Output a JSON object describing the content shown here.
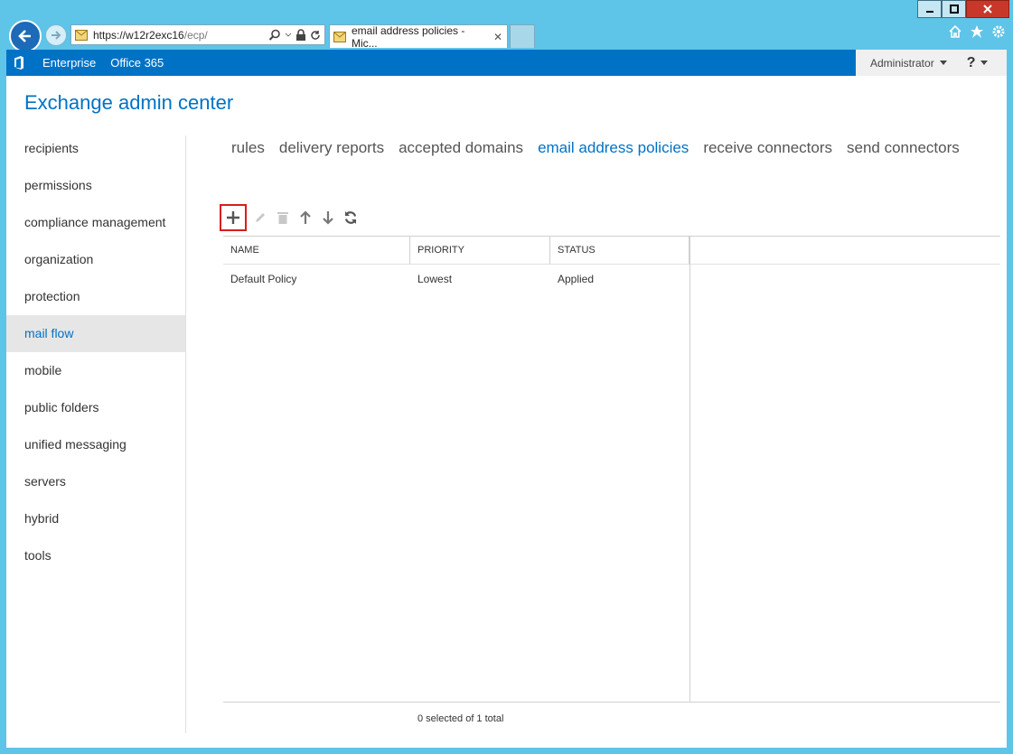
{
  "browser": {
    "address_host": "https://w12r2exc16",
    "address_path": "/ecp/",
    "tab_title": "email address policies - Mic...",
    "tab_close": "✕"
  },
  "topnav": {
    "enterprise": "Enterprise",
    "office365": "Office 365",
    "user": "Administrator",
    "help": "?"
  },
  "app_title": "Exchange admin center",
  "sidebar": {
    "items": [
      {
        "label": "recipients"
      },
      {
        "label": "permissions"
      },
      {
        "label": "compliance management"
      },
      {
        "label": "organization"
      },
      {
        "label": "protection"
      },
      {
        "label": "mail flow"
      },
      {
        "label": "mobile"
      },
      {
        "label": "public folders"
      },
      {
        "label": "unified messaging"
      },
      {
        "label": "servers"
      },
      {
        "label": "hybrid"
      },
      {
        "label": "tools"
      }
    ]
  },
  "tabs": [
    {
      "label": "rules"
    },
    {
      "label": "delivery reports"
    },
    {
      "label": "accepted domains"
    },
    {
      "label": "email address policies"
    },
    {
      "label": "receive connectors"
    },
    {
      "label": "send connectors"
    }
  ],
  "table": {
    "columns": [
      "NAME",
      "PRIORITY",
      "STATUS"
    ],
    "rows": [
      {
        "name": "Default Policy",
        "priority": "Lowest",
        "status": "Applied"
      }
    ]
  },
  "status_text": "0 selected of 1 total",
  "colors": {
    "accent": "#0072c6",
    "highlight_box": "#d81d1d",
    "chrome": "#5ec4e8"
  }
}
